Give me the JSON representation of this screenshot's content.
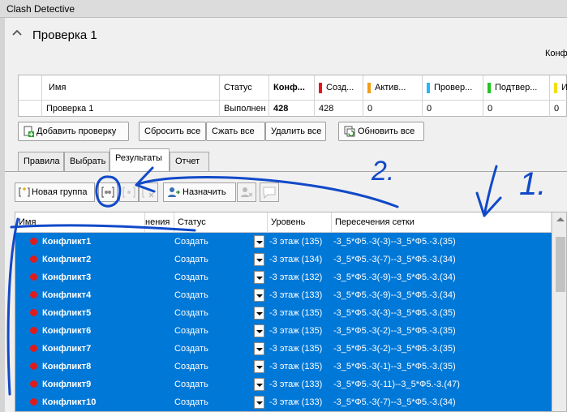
{
  "window": {
    "title": "Clash Detective"
  },
  "section": {
    "title": "Проверка 1",
    "right_cut_label": "Конф"
  },
  "summary": {
    "headers": [
      "Имя",
      "Статус",
      "Конф...",
      "Созд...",
      "Актив...",
      "Провер...",
      "Подтвер...",
      "И"
    ],
    "row": [
      "Проверка 1",
      "Выполнен",
      "428",
      "428",
      "0",
      "0",
      "0",
      "0"
    ],
    "status_colors": {
      "new": "#e8141a",
      "active": "#f39c12",
      "reviewed": "#29b6f6",
      "approved": "#22c422",
      "resolved": "#f0e000"
    }
  },
  "buttons": {
    "add_test": "Добавить проверку",
    "reset_all": "Сбросить все",
    "compact_all": "Сжать все",
    "delete_all": "Удалить все",
    "update_all": "Обновить все"
  },
  "tabs": [
    "Правила",
    "Выбрать",
    "Результаты",
    "Отчет"
  ],
  "results_toolbar": {
    "new_group": "Новая группа",
    "assign": "Назначить"
  },
  "grid": {
    "headers": {
      "name": "Имя",
      "hidden": "нения",
      "status": "Статус",
      "level": "Уровень",
      "gridline": "Пересечения сетки"
    },
    "rows": [
      {
        "name": "Конфликт1",
        "status": "Создать",
        "level": "-3 этаж (135)",
        "grid": "-3_5*Ф5.-3(-3)--3_5*Ф5.-3.(35)"
      },
      {
        "name": "Конфликт2",
        "status": "Создать",
        "level": "-3 этаж (134)",
        "grid": "-3_5*Ф5.-3(-7)--3_5*Ф5.-3.(34)"
      },
      {
        "name": "Конфликт3",
        "status": "Создать",
        "level": "-3 этаж (132)",
        "grid": "-3_5*Ф5.-3(-9)--3_5*Ф5.-3.(34)"
      },
      {
        "name": "Конфликт4",
        "status": "Создать",
        "level": "-3 этаж (133)",
        "grid": "-3_5*Ф5.-3(-9)--3_5*Ф5.-3.(34)"
      },
      {
        "name": "Конфликт5",
        "status": "Создать",
        "level": "-3 этаж (135)",
        "grid": "-3_5*Ф5.-3(-3)--3_5*Ф5.-3.(35)"
      },
      {
        "name": "Конфликт6",
        "status": "Создать",
        "level": "-3 этаж (135)",
        "grid": "-3_5*Ф5.-3(-2)--3_5*Ф5.-3.(35)"
      },
      {
        "name": "Конфликт7",
        "status": "Создать",
        "level": "-3 этаж (135)",
        "grid": "-3_5*Ф5.-3(-2)--3_5*Ф5.-3.(35)"
      },
      {
        "name": "Конфликт8",
        "status": "Создать",
        "level": "-3 этаж (135)",
        "grid": "-3_5*Ф5.-3(-1)--3_5*Ф5.-3.(35)"
      },
      {
        "name": "Конфликт9",
        "status": "Создать",
        "level": "-3 этаж (133)",
        "grid": "-3_5*Ф5.-3(-11)--3_5*Ф5.-3.(47)"
      },
      {
        "name": "Конфликт10",
        "status": "Создать",
        "level": "-3 этаж (133)",
        "grid": "-3_5*Ф5.-3(-7)--3_5*Ф5.-3.(34)"
      }
    ]
  },
  "annotations": {
    "label_1": "1.",
    "label_2": "2.",
    "ink_color": "#1149c9"
  }
}
